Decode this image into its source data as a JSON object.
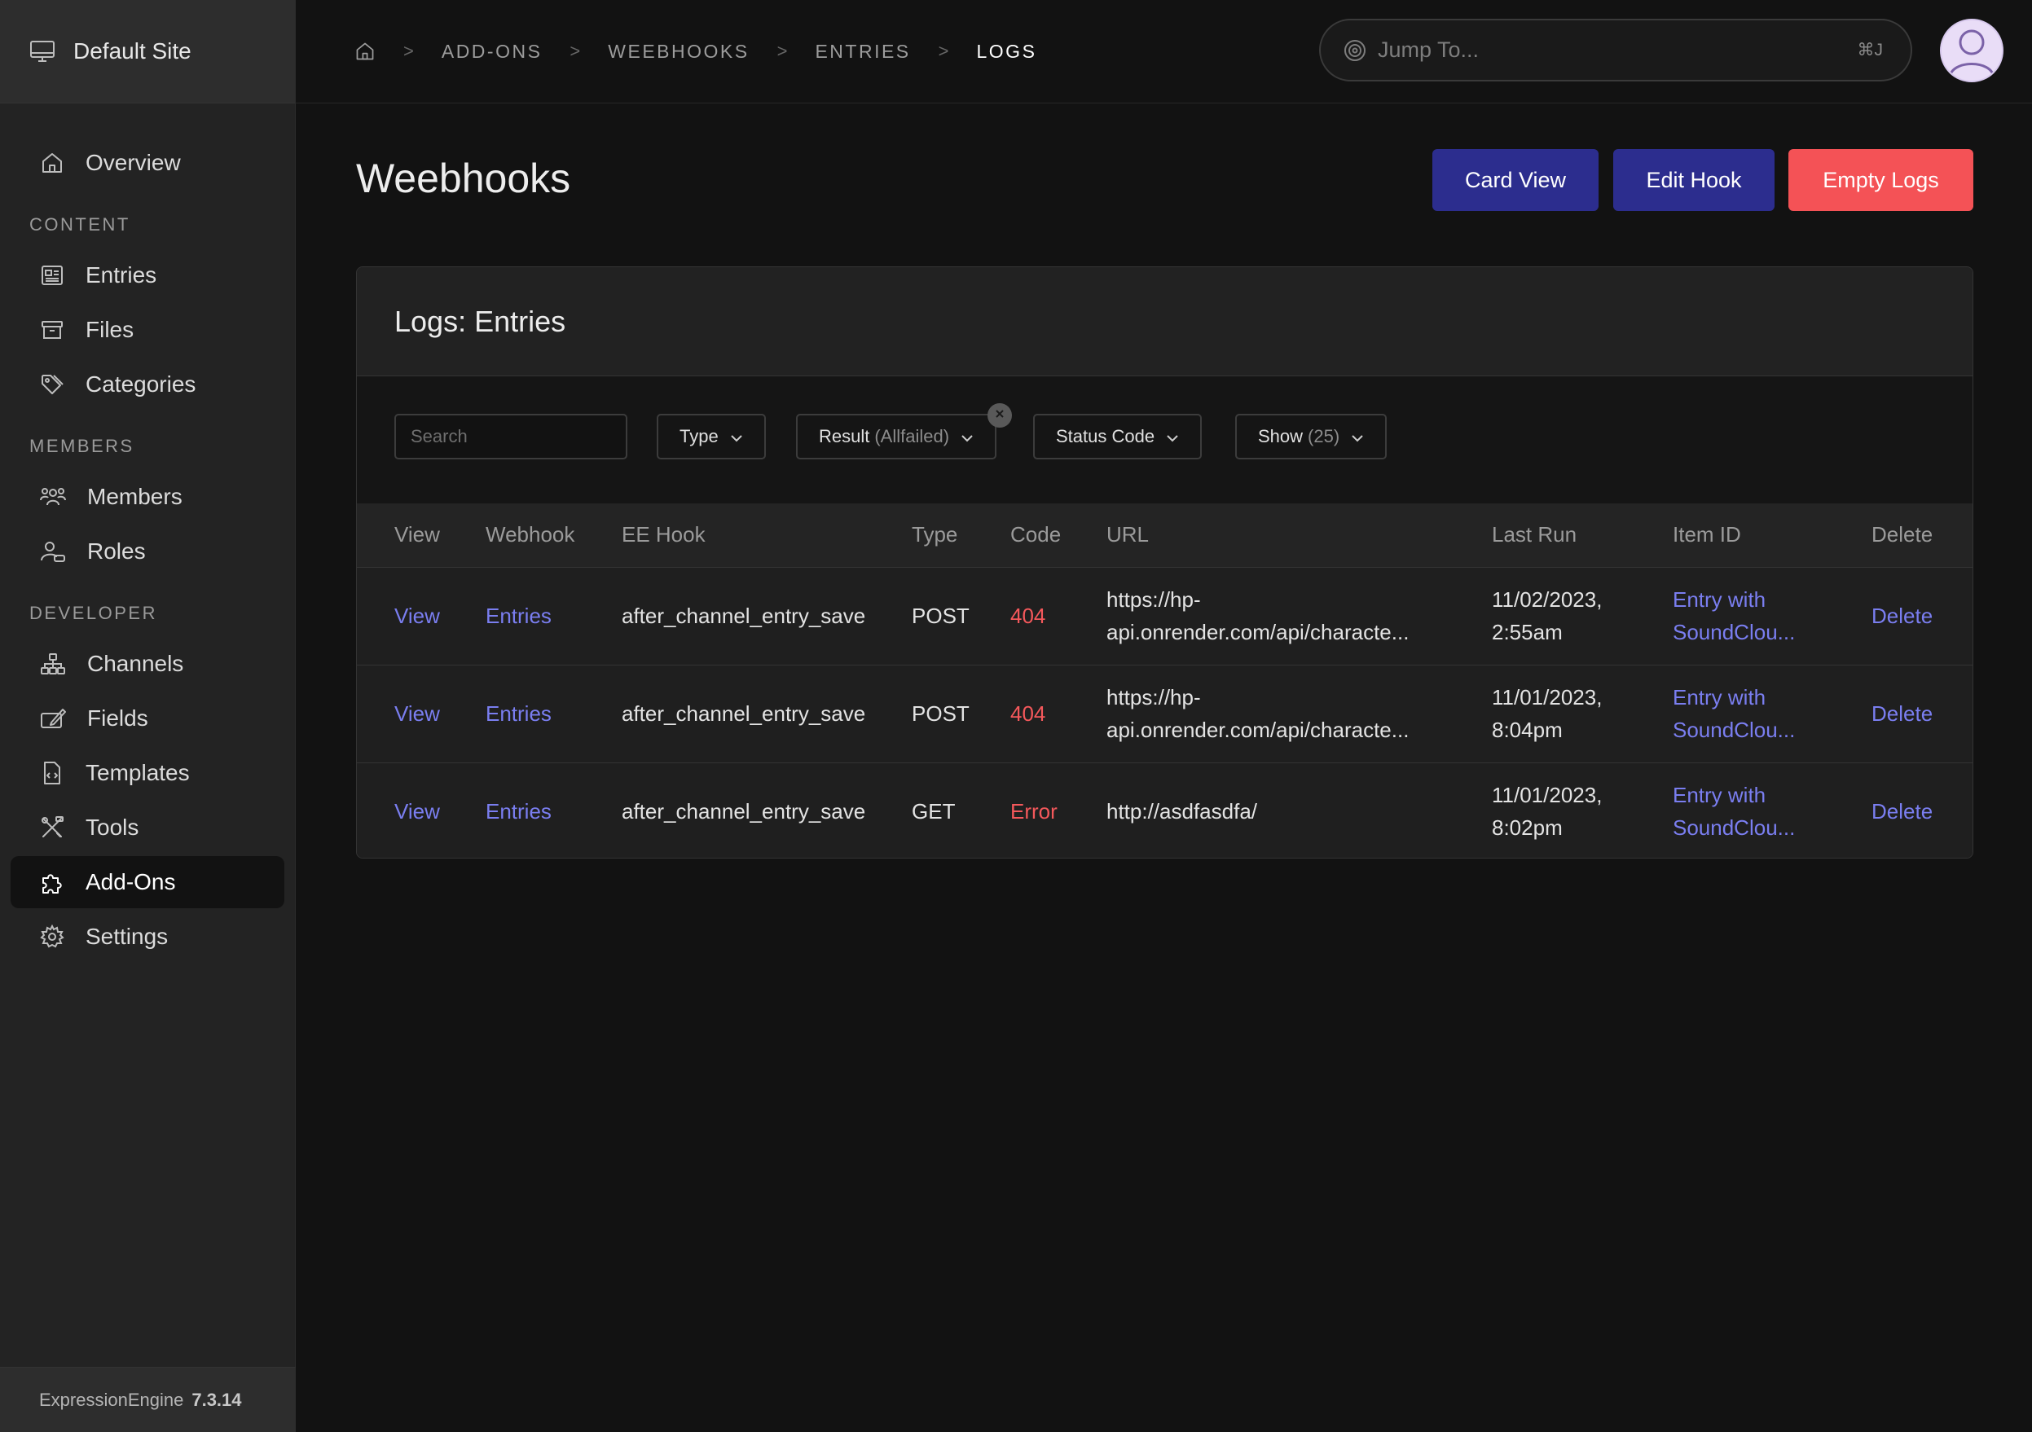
{
  "site": {
    "name": "Default Site"
  },
  "sidebar": {
    "overview": "Overview",
    "sections": {
      "content": "CONTENT",
      "members": "MEMBERS",
      "developer": "DEVELOPER"
    },
    "content_items": [
      "Entries",
      "Files",
      "Categories"
    ],
    "member_items": [
      "Members",
      "Roles"
    ],
    "developer_items": [
      "Channels",
      "Fields",
      "Templates",
      "Tools",
      "Add-Ons",
      "Settings"
    ],
    "active": "Add-Ons"
  },
  "footer": {
    "product": "ExpressionEngine",
    "version": "7.3.14"
  },
  "breadcrumb": {
    "items": [
      "ADD-ONS",
      "WEEBHOOKS",
      "ENTRIES",
      "LOGS"
    ],
    "separator": ">"
  },
  "jump": {
    "placeholder": "Jump To...",
    "shortcut": "⌘J"
  },
  "page": {
    "title": "Weebhooks"
  },
  "actions": {
    "card_view": "Card View",
    "edit_hook": "Edit Hook",
    "empty_logs": "Empty Logs"
  },
  "panel": {
    "title": "Logs: Entries"
  },
  "filters": {
    "search_placeholder": "Search",
    "type": "Type",
    "result": "Result",
    "result_value": "(Allfailed)",
    "status_code": "Status Code",
    "show": "Show",
    "show_value": "(25)"
  },
  "table": {
    "columns": [
      "View",
      "Webhook",
      "EE Hook",
      "Type",
      "Code",
      "URL",
      "Last Run",
      "Item ID",
      "Delete"
    ],
    "rows": [
      {
        "view": "View",
        "webhook": "Entries",
        "hook": "after_channel_entry_save",
        "type": "POST",
        "code": "404",
        "url_1": "https://hp-",
        "url_2": "api.onrender.com/api/characte...",
        "run_1": "11/02/2023,",
        "run_2": "2:55am",
        "item_1": "Entry with",
        "item_2": "SoundClou...",
        "delete": "Delete"
      },
      {
        "view": "View",
        "webhook": "Entries",
        "hook": "after_channel_entry_save",
        "type": "POST",
        "code": "404",
        "url_1": "https://hp-",
        "url_2": "api.onrender.com/api/characte...",
        "run_1": "11/01/2023,",
        "run_2": "8:04pm",
        "item_1": "Entry with",
        "item_2": "SoundClou...",
        "delete": "Delete"
      },
      {
        "view": "View",
        "webhook": "Entries",
        "hook": "after_channel_entry_save",
        "type": "GET",
        "code": "Error",
        "url_1": "http://asdfasdfa/",
        "url_2": "",
        "run_1": "11/01/2023,",
        "run_2": "8:02pm",
        "item_1": "Entry with",
        "item_2": "SoundClou...",
        "delete": "Delete"
      }
    ]
  },
  "colors": {
    "accent": "#2c2d8e",
    "danger": "#f45256",
    "link": "#7a7ef0"
  }
}
